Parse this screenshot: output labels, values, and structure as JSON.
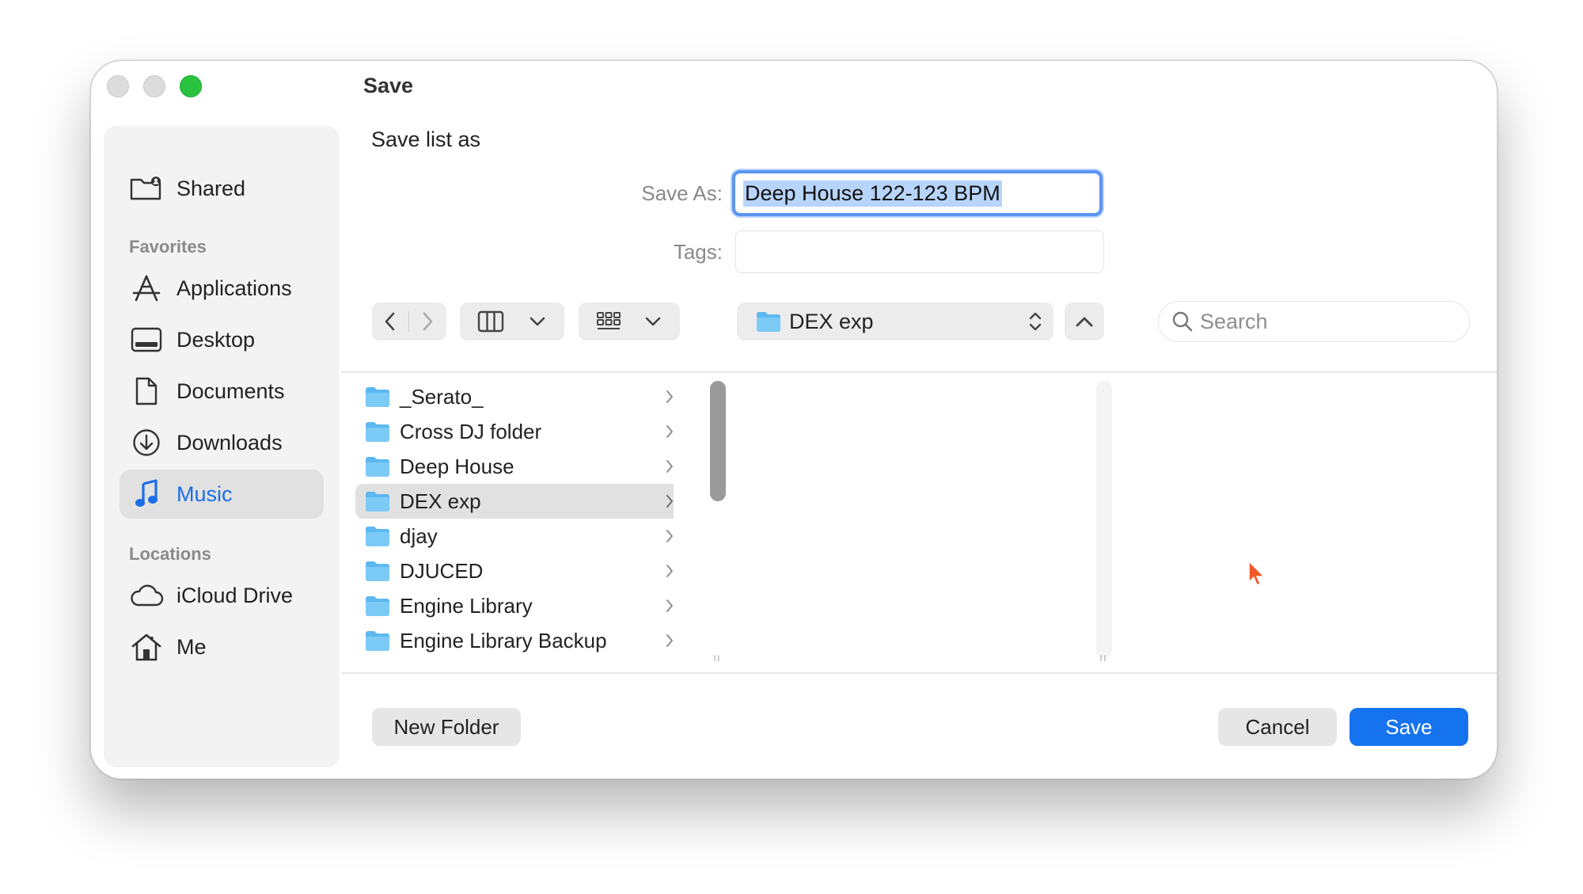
{
  "window": {
    "title": "Save",
    "prompt": "Save list as"
  },
  "sidebar": {
    "shared": {
      "label": "Shared",
      "icon": "shared-folder-icon"
    },
    "favorites_header": "Favorites",
    "favorites": [
      {
        "label": "Applications",
        "icon": "applications-icon"
      },
      {
        "label": "Desktop",
        "icon": "desktop-icon"
      },
      {
        "label": "Documents",
        "icon": "document-icon"
      },
      {
        "label": "Downloads",
        "icon": "download-icon"
      },
      {
        "label": "Music",
        "icon": "music-note-icon",
        "selected": true
      }
    ],
    "locations_header": "Locations",
    "locations": [
      {
        "label": "iCloud Drive",
        "icon": "cloud-icon"
      },
      {
        "label": "Me",
        "icon": "home-icon"
      }
    ]
  },
  "form": {
    "save_as_label": "Save As:",
    "save_as_value": "Deep House 122-123 BPM",
    "tags_label": "Tags:",
    "tags_value": ""
  },
  "toolbar": {
    "location": "DEX exp",
    "search_placeholder": "Search"
  },
  "browser": {
    "items": [
      {
        "name": "_Serato_"
      },
      {
        "name": "Cross DJ folder"
      },
      {
        "name": "Deep House"
      },
      {
        "name": "DEX exp",
        "selected": true
      },
      {
        "name": "djay"
      },
      {
        "name": "DJUCED"
      },
      {
        "name": "Engine Library"
      },
      {
        "name": "Engine Library Backup"
      }
    ]
  },
  "buttons": {
    "new_folder": "New Folder",
    "cancel": "Cancel",
    "save": "Save"
  },
  "colors": {
    "accent": "#1673f0",
    "folder": "#5db8f0",
    "zoom_button": "#29c33f",
    "cursor": "#f05a28"
  }
}
